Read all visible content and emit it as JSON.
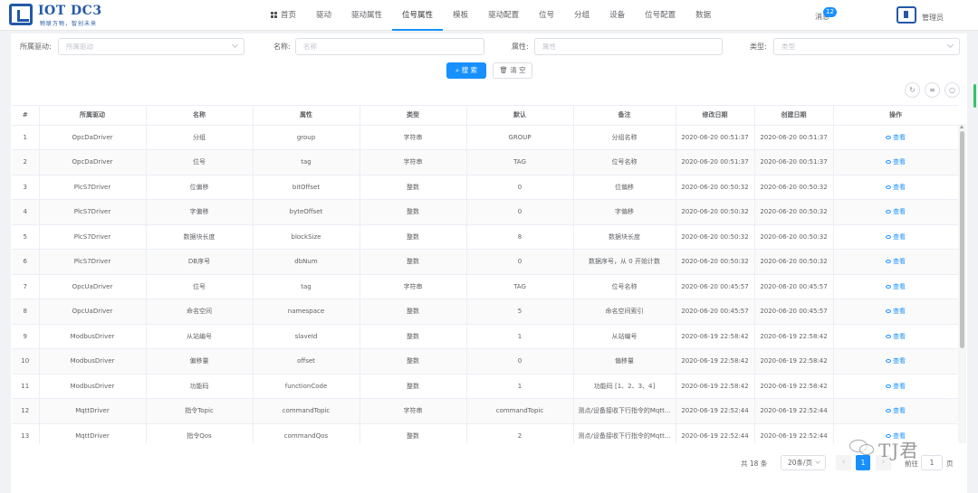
{
  "header": {
    "logo_title": "IOT DC3",
    "logo_subtitle": "物联万物，智创未来",
    "nav": [
      {
        "label": "首页",
        "icon": "grid-icon",
        "active": false
      },
      {
        "label": "驱动",
        "active": false
      },
      {
        "label": "驱动属性",
        "active": false
      },
      {
        "label": "位号属性",
        "active": true
      },
      {
        "label": "模板",
        "active": false
      },
      {
        "label": "驱动配置",
        "active": false
      },
      {
        "label": "位号",
        "active": false
      },
      {
        "label": "分组",
        "active": false
      },
      {
        "label": "设备",
        "active": false
      },
      {
        "label": "位号配置",
        "active": false
      },
      {
        "label": "数据",
        "active": false
      }
    ],
    "messages_label": "消息",
    "messages_count": "12",
    "admin_label": "管理员"
  },
  "filters": {
    "driver_label": "所属驱动:",
    "driver_placeholder": "所属驱动",
    "name_label": "名称:",
    "name_placeholder": "名称",
    "attr_label": "属性:",
    "attr_placeholder": "属性",
    "type_label": "类型:",
    "type_placeholder": "类型",
    "search_button": "搜 索",
    "clear_button": "清 空"
  },
  "toolbar": {
    "refresh_icon": "refresh-icon",
    "sort_icon": "sort-icon",
    "search_icon": "search-icon"
  },
  "table": {
    "columns": [
      "#",
      "所属驱动",
      "名称",
      "属性",
      "类型",
      "默认",
      "备注",
      "修改日期",
      "创建日期",
      "操作"
    ],
    "view_label": "查看",
    "rows": [
      [
        "1",
        "OpcDaDriver",
        "分组",
        "group",
        "字符串",
        "GROUP",
        "分组名称",
        "2020-06-20 00:51:37",
        "2020-06-20 00:51:37"
      ],
      [
        "2",
        "OpcDaDriver",
        "位号",
        "tag",
        "字符串",
        "TAG",
        "位号名称",
        "2020-06-20 00:51:37",
        "2020-06-20 00:51:37"
      ],
      [
        "3",
        "PlcS7Driver",
        "位偏移",
        "bitOffset",
        "整数",
        "0",
        "位偏移",
        "2020-06-20 00:50:32",
        "2020-06-20 00:50:32"
      ],
      [
        "4",
        "PlcS7Driver",
        "字偏移",
        "byteOffset",
        "整数",
        "0",
        "字偏移",
        "2020-06-20 00:50:32",
        "2020-06-20 00:50:32"
      ],
      [
        "5",
        "PlcS7Driver",
        "数据块长度",
        "blockSize",
        "整数",
        "8",
        "数据块长度",
        "2020-06-20 00:50:32",
        "2020-06-20 00:50:32"
      ],
      [
        "6",
        "PlcS7Driver",
        "DB序号",
        "dbNum",
        "整数",
        "0",
        "数据序号，从 0 开始计数",
        "2020-06-20 00:50:32",
        "2020-06-20 00:50:32"
      ],
      [
        "7",
        "OpcUaDriver",
        "位号",
        "tag",
        "字符串",
        "TAG",
        "位号名称",
        "2020-06-20 00:45:57",
        "2020-06-20 00:45:57"
      ],
      [
        "8",
        "OpcUaDriver",
        "命名空间",
        "namespace",
        "整数",
        "5",
        "命名空间索引",
        "2020-06-20 00:45:57",
        "2020-06-20 00:45:57"
      ],
      [
        "9",
        "ModbusDriver",
        "从站编号",
        "slaveId",
        "整数",
        "1",
        "从站编号",
        "2020-06-19 22:58:42",
        "2020-06-19 22:58:42"
      ],
      [
        "10",
        "ModbusDriver",
        "偏移量",
        "offset",
        "整数",
        "0",
        "偏移量",
        "2020-06-19 22:58:42",
        "2020-06-19 22:58:42"
      ],
      [
        "11",
        "ModbusDriver",
        "功能码",
        "functionCode",
        "整数",
        "1",
        "功能码 [1、2、3、4]",
        "2020-06-19 22:58:42",
        "2020-06-19 22:58:42"
      ],
      [
        "12",
        "MqttDriver",
        "指令Topic",
        "commandTopic",
        "字符串",
        "commandTopic",
        "测点/设备接收下行指令的Mqtt...",
        "2020-06-19 22:52:44",
        "2020-06-19 22:52:44"
      ],
      [
        "13",
        "MqttDriver",
        "指令Qos",
        "commandQos",
        "整数",
        "2",
        "测点/设备接收下行指令的Mqtt...",
        "2020-06-19 22:52:44",
        "2020-06-19 22:52:44"
      ]
    ]
  },
  "pagination": {
    "total_text": "共 18 条",
    "page_size": "20条/页",
    "current_page": "1",
    "goto_label": "前往",
    "goto_value": "1",
    "goto_unit": "页"
  },
  "watermark": {
    "text": "TJ君"
  },
  "colors": {
    "primary": "#1890ff",
    "brand": "#2358a8",
    "accent_green": "#33c36a"
  }
}
